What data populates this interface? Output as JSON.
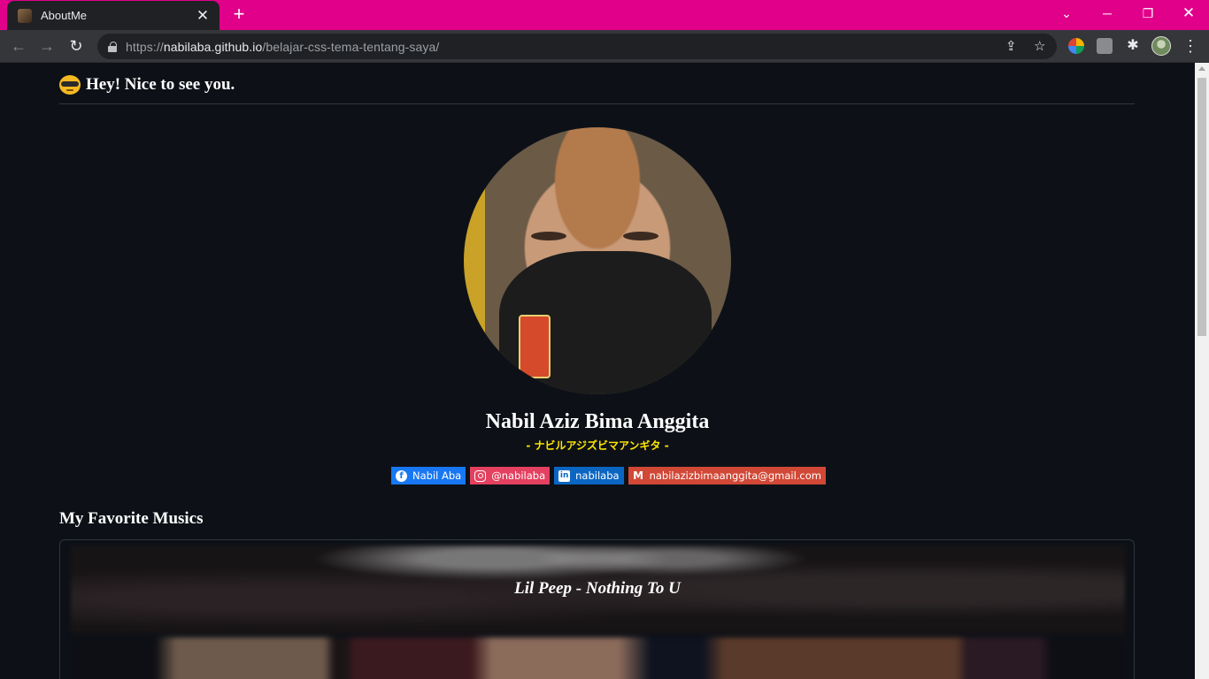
{
  "browser": {
    "tab_title": "AboutMe",
    "url_scheme": "https://",
    "url_host": "nabilaba.github.io",
    "url_path": "/belajar-css-tema-tentang-saya/",
    "accent_color": "#e0008a"
  },
  "page": {
    "greeting": "Hey! Nice to see you.",
    "name": "Nabil Aziz Bima Anggita",
    "subname": "- ナビルアジズビマアンギタ -",
    "social": [
      {
        "label": "Nabil Aba",
        "icon": "facebook-icon",
        "color": "#1877f2"
      },
      {
        "label": "@nabilaba",
        "icon": "instagram-icon",
        "color": "#e4405f"
      },
      {
        "label": "nabilaba",
        "icon": "linkedin-icon",
        "color": "#0a66c2"
      },
      {
        "label": "nabilazizbimaanggita@gmail.com",
        "icon": "gmail-icon",
        "color": "#d14836"
      }
    ],
    "music_section_title": "My Favorite Musics",
    "song_title": "Lil Peep - Nothing To U",
    "subname_color": "#ffe600",
    "background_color": "#0d1117"
  }
}
